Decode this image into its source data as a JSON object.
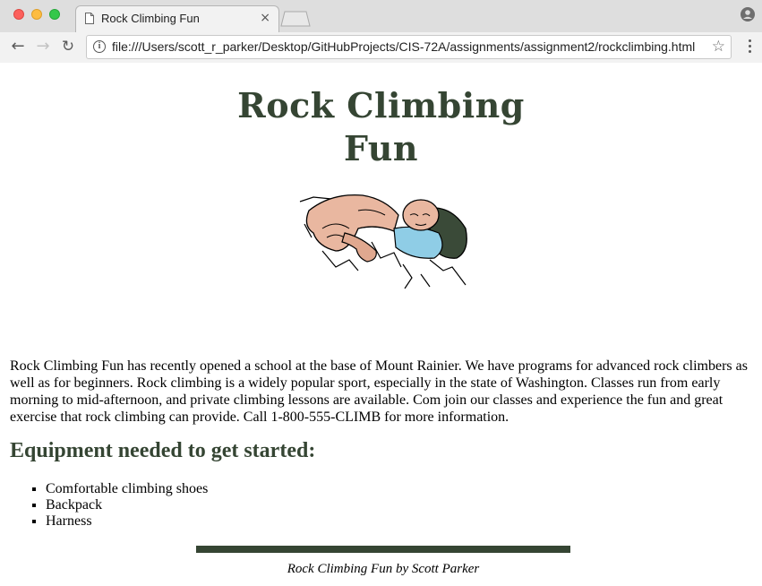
{
  "browser": {
    "tab_title": "Rock Climbing Fun",
    "tab_close": "×",
    "url": "file:///Users/scott_r_parker/Desktop/GitHubProjects/CIS-72A/assignments/assignment2/rockclimbing.html",
    "back": "←",
    "forward": "→",
    "reload": "↻",
    "info": "i",
    "star": "☆"
  },
  "page": {
    "title": "Rock Climbing Fun",
    "hero_icon": "rock-climber-illustration",
    "intro": "Rock Climbing Fun has recently opened a school at the base of Mount Rainier. We have programs for advanced rock climbers as well as for beginners. Rock climbing is a widely popular sport, especially in the state of Washington. Classes run from early morning to mid-afternoon, and private climbing lessons are available. Com join our classes and experience the fun and great exercise that rock climbing can provide. Call 1-800-555-CLIMB for more information.",
    "equipment_heading": "Equipment needed to get started:",
    "equipment": [
      "Comfortable climbing shoes",
      "Backpack",
      "Harness"
    ],
    "footer": "Rock Climbing Fun by Scott Parker"
  },
  "colors": {
    "heading": "#354533",
    "rule": "#354533"
  }
}
